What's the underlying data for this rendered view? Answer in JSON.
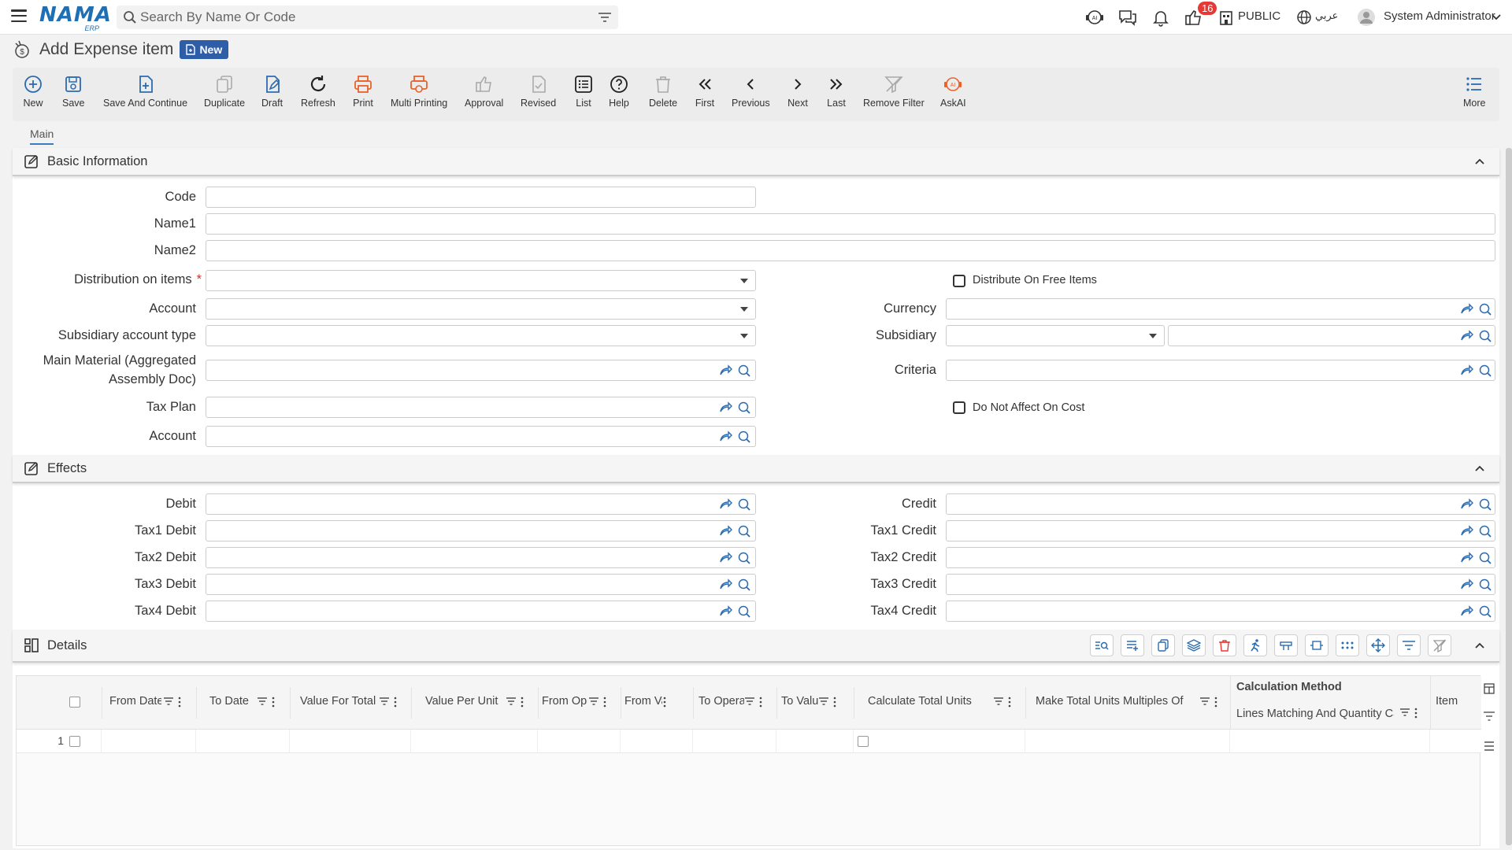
{
  "topbar": {
    "logo_text": "NAMA",
    "logo_sub": "ERP",
    "search_placeholder": "Search By Name Or Code",
    "notifications_count": "16",
    "public_label": "PUBLIC",
    "language_label": "عربي",
    "user_name": "System Administrator"
  },
  "page": {
    "title": "Add Expense item",
    "status_badge": "New"
  },
  "toolbar": [
    {
      "key": "new",
      "label": "New",
      "icon": "plus-circle-icon"
    },
    {
      "key": "save",
      "label": "Save",
      "icon": "save-icon"
    },
    {
      "key": "save-continue",
      "label": "Save And Continue",
      "icon": "file-plus-icon"
    },
    {
      "key": "duplicate",
      "label": "Duplicate",
      "icon": "copy-icon"
    },
    {
      "key": "draft",
      "label": "Draft",
      "icon": "edit-file-icon"
    },
    {
      "key": "refresh",
      "label": "Refresh",
      "icon": "refresh-icon"
    },
    {
      "key": "print",
      "label": "Print",
      "icon": "printer-icon"
    },
    {
      "key": "multi-printing",
      "label": "Multi Printing",
      "icon": "multi-printer-icon"
    },
    {
      "key": "approval",
      "label": "Approval",
      "icon": "thumbs-up-icon"
    },
    {
      "key": "revised",
      "label": "Revised",
      "icon": "check-file-icon"
    },
    {
      "key": "list",
      "label": "List",
      "icon": "list-icon"
    },
    {
      "key": "help",
      "label": "Help",
      "icon": "help-icon"
    },
    {
      "key": "delete",
      "label": "Delete",
      "icon": "trash-icon"
    },
    {
      "key": "first",
      "label": "First",
      "icon": "double-chevron-left-icon"
    },
    {
      "key": "previous",
      "label": "Previous",
      "icon": "chevron-left-icon"
    },
    {
      "key": "next",
      "label": "Next",
      "icon": "chevron-right-icon"
    },
    {
      "key": "last",
      "label": "Last",
      "icon": "double-chevron-right-icon"
    },
    {
      "key": "remove-filter",
      "label": "Remove Filter",
      "icon": "filter-off-icon"
    },
    {
      "key": "askai",
      "label": "AskAI",
      "icon": "ai-icon"
    },
    {
      "key": "more",
      "label": "More",
      "icon": "more-list-icon"
    }
  ],
  "tabs": {
    "main": "Main"
  },
  "basic": {
    "title": "Basic Information",
    "code": "Code",
    "name1": "Name1",
    "name2": "Name2",
    "distribution": "Distribution on items",
    "required_mark": "*",
    "distribute_free": "Distribute On Free Items",
    "account": "Account",
    "currency": "Currency",
    "subsidiary_type": "Subsidiary account type",
    "subsidiary": "Subsidiary",
    "main_material_1": "Main Material (Aggregated",
    "main_material_2": "Assembly Doc)",
    "criteria": "Criteria",
    "tax_plan": "Tax Plan",
    "not_affect_cost": "Do Not Affect On Cost",
    "account2": "Account"
  },
  "effects": {
    "title": "Effects",
    "debit": "Debit",
    "credit": "Credit",
    "tax1_debit": "Tax1 Debit",
    "tax1_credit": "Tax1 Credit",
    "tax2_debit": "Tax2 Debit",
    "tax2_credit": "Tax2 Credit",
    "tax3_debit": "Tax3 Debit",
    "tax3_credit": "Tax3 Credit",
    "tax4_debit": "Tax4 Debit",
    "tax4_credit": "Tax4 Credit"
  },
  "details": {
    "title": "Details",
    "columns": {
      "from_date": "From Date",
      "to_date": "To Date",
      "value_total": "Value For Total",
      "value_unit": "Value Per Unit",
      "from_op": "From Ope",
      "from_v": "From Va",
      "to_opera": "To Opera",
      "to_valu": "To Valu",
      "calc_total_units": "Calculate Total Units",
      "make_multiples": "Make Total Units Multiples Of",
      "calc_method": "Calculation Method",
      "lines_matching": "Lines Matching And Quantity Calc",
      "item": "Item"
    },
    "rows": [
      {
        "num": "1"
      }
    ]
  }
}
